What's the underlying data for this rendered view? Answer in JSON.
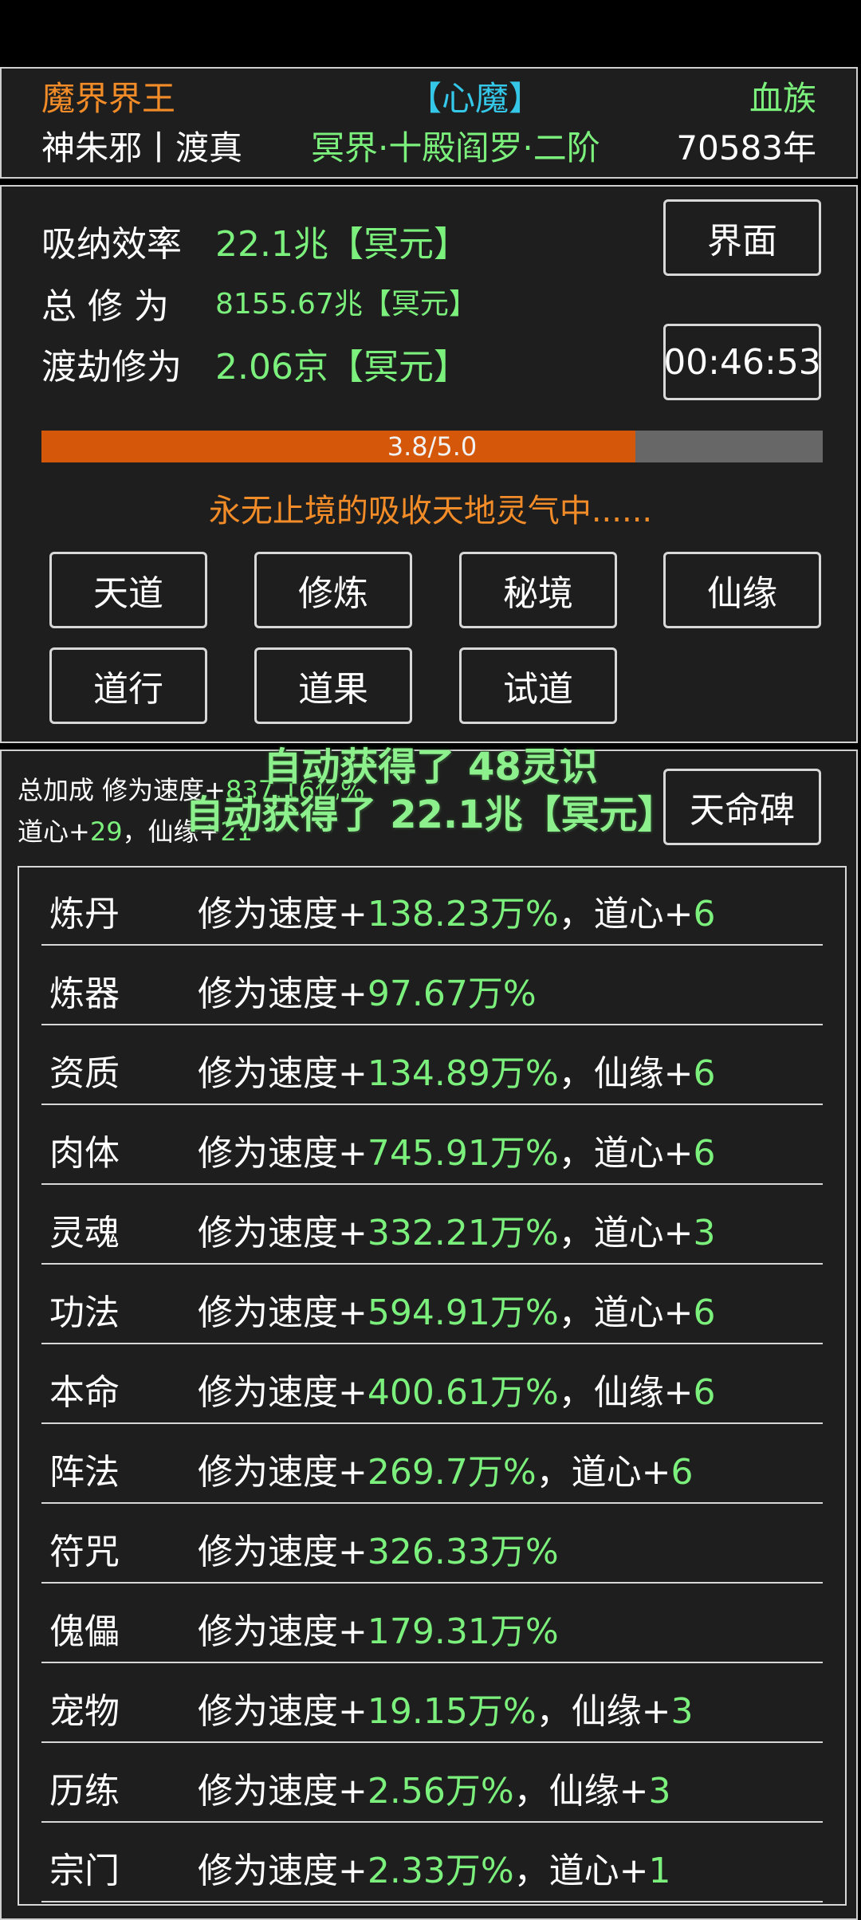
{
  "header": {
    "realm_title": "魔界界王",
    "heart_demon": "【心魔】",
    "race": "血族",
    "player_name": "神朱邪丨渡真",
    "realm_stage": "冥界·十殿阎罗·二阶",
    "age": "70583年"
  },
  "stats": {
    "absorb_label": "吸纳效率",
    "absorb_value": "22.1兆【冥元】",
    "total_label": "总 修 为",
    "total_value": "8155.67兆【冥元】",
    "tribulation_label": "渡劫修为",
    "tribulation_value": "2.06京【冥元】"
  },
  "buttons": {
    "interface": "界面",
    "timer": "00:46:53",
    "tiandao": "天道",
    "xiulian": "修炼",
    "mijing": "秘境",
    "xianyuan": "仙缘",
    "daoxing": "道行",
    "daoguo": "道果",
    "shidao": "试道",
    "tianmingbei": "天命碑"
  },
  "progress": {
    "text": "3.8/5.0",
    "fraction": 0.76
  },
  "status_message": "永无止境的吸收天地灵气中......",
  "bonus": {
    "prefix": "总加成 修为速度+",
    "speed_value": "837.16亿%",
    "daoxin_label": "道心+",
    "daoxin_value": "29",
    "sep": "，仙缘+",
    "xianyuan_value": "21"
  },
  "notifications": [
    "自动获得了 48灵识",
    "自动获得了 22.1兆【冥元】"
  ],
  "list": [
    {
      "name": "炼丹",
      "prefix": "修为速度+",
      "value": "138.23万%",
      "extra_label": "，道心+",
      "extra_value": "6"
    },
    {
      "name": "炼器",
      "prefix": "修为速度+",
      "value": "97.67万%",
      "extra_label": "",
      "extra_value": ""
    },
    {
      "name": "资质",
      "prefix": "修为速度+",
      "value": "134.89万%",
      "extra_label": "，仙缘+",
      "extra_value": "6"
    },
    {
      "name": "肉体",
      "prefix": "修为速度+",
      "value": "745.91万%",
      "extra_label": "，道心+",
      "extra_value": "6"
    },
    {
      "name": "灵魂",
      "prefix": "修为速度+",
      "value": "332.21万%",
      "extra_label": "，道心+",
      "extra_value": "3"
    },
    {
      "name": "功法",
      "prefix": "修为速度+",
      "value": "594.91万%",
      "extra_label": "，道心+",
      "extra_value": "6"
    },
    {
      "name": "本命",
      "prefix": "修为速度+",
      "value": "400.61万%",
      "extra_label": "，仙缘+",
      "extra_value": "6"
    },
    {
      "name": "阵法",
      "prefix": "修为速度+",
      "value": "269.7万%",
      "extra_label": "，道心+",
      "extra_value": "6"
    },
    {
      "name": "符咒",
      "prefix": "修为速度+",
      "value": "326.33万%",
      "extra_label": "",
      "extra_value": ""
    },
    {
      "name": "傀儡",
      "prefix": "修为速度+",
      "value": "179.31万%",
      "extra_label": "",
      "extra_value": ""
    },
    {
      "name": "宠物",
      "prefix": "修为速度+",
      "value": "19.15万%",
      "extra_label": "，仙缘+",
      "extra_value": "3"
    },
    {
      "name": "历练",
      "prefix": "修为速度+",
      "value": "2.56万%",
      "extra_label": "，仙缘+",
      "extra_value": "3"
    },
    {
      "name": "宗门",
      "prefix": "修为速度+",
      "value": "2.33万%",
      "extra_label": "，道心+",
      "extra_value": "1"
    }
  ],
  "colors": {
    "accent_green": "#7CF07C",
    "title_orange": "#F28C28",
    "heart_demon_cyan": "#34C7E8",
    "progress_fill": "#D4570A",
    "progress_track": "#676767",
    "panel_bg": "#1e1e1e"
  }
}
